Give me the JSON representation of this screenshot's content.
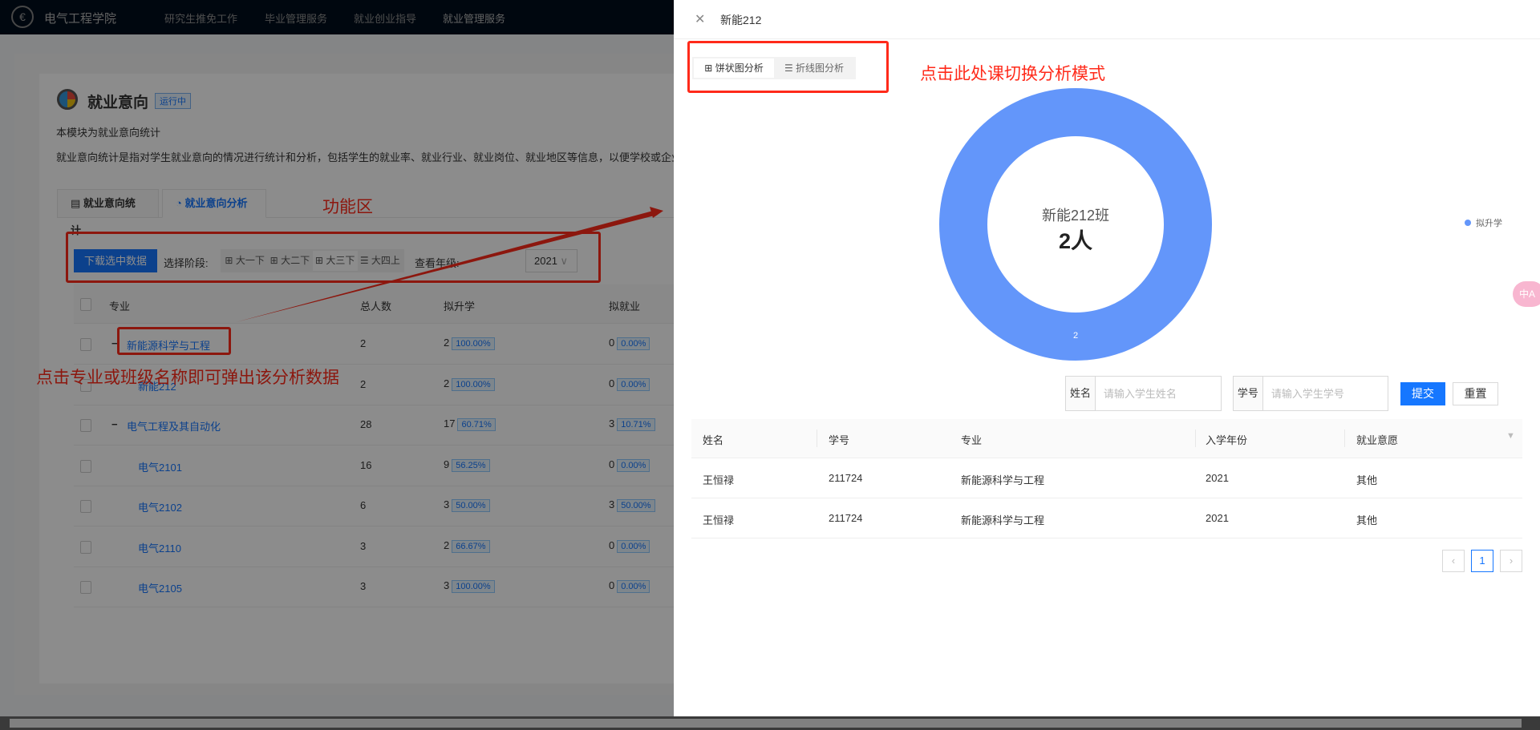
{
  "nav": {
    "title": "电气工程学院",
    "items": [
      "研究生推免工作",
      "毕业管理服务",
      "就业创业指导",
      "就业管理服务"
    ]
  },
  "page": {
    "title": "就业意向",
    "status": "运行中",
    "desc1": "本模块为就业意向统计",
    "desc2": "就业意向统计是指对学生就业意向的情况进行统计和分析，包括学生的就业率、就业行业、就业岗位、就业地区等信息，以便学校或企业更"
  },
  "tabs": [
    "就业意向统计",
    "就业意向分析"
  ],
  "toolbar": {
    "download": "下载选中数据",
    "stage_label": "选择阶段:",
    "stages": [
      "大一下",
      "大二下",
      "大三下",
      "大四上"
    ],
    "active_stage": "大三下",
    "grade_label": "查看年级:",
    "grade": "2021"
  },
  "table": {
    "headers": [
      "专业",
      "总人数",
      "拟升学",
      "拟就业"
    ],
    "rows": [
      {
        "name": "新能源科学与工程",
        "total": "2",
        "up": "2",
        "up_pct": "100.00%",
        "job": "0",
        "job_pct": "0.00%",
        "level": 0
      },
      {
        "name": "新能212",
        "total": "2",
        "up": "2",
        "up_pct": "100.00%",
        "job": "0",
        "job_pct": "0.00%",
        "level": 1
      },
      {
        "name": "电气工程及其自动化",
        "total": "28",
        "up": "17",
        "up_pct": "60.71%",
        "job": "3",
        "job_pct": "10.71%",
        "level": 0
      },
      {
        "name": "电气2101",
        "total": "16",
        "up": "9",
        "up_pct": "56.25%",
        "job": "0",
        "job_pct": "0.00%",
        "level": 1
      },
      {
        "name": "电气2102",
        "total": "6",
        "up": "3",
        "up_pct": "50.00%",
        "job": "3",
        "job_pct": "50.00%",
        "level": 1
      },
      {
        "name": "电气2110",
        "total": "3",
        "up": "2",
        "up_pct": "66.67%",
        "job": "0",
        "job_pct": "0.00%",
        "level": 1
      },
      {
        "name": "电气2105",
        "total": "3",
        "up": "3",
        "up_pct": "100.00%",
        "job": "0",
        "job_pct": "0.00%",
        "level": 1
      }
    ]
  },
  "annotations": {
    "func": "功能区",
    "click": "点击专业或班级名称即可弹出该分析数据",
    "switch": "点击此处课切换分析模式"
  },
  "drawer": {
    "title": "新能212",
    "modes": [
      "饼状图分析",
      "折线图分析"
    ],
    "active_mode": "饼状图分析",
    "form": {
      "name_label": "姓名",
      "name_placeholder": "请输入学生姓名",
      "id_label": "学号",
      "id_placeholder": "请输入学生学号",
      "submit": "提交",
      "reset": "重置"
    },
    "table": {
      "headers": [
        "姓名",
        "学号",
        "专业",
        "入学年份",
        "就业意愿"
      ],
      "rows": [
        [
          "王恒禄",
          "211724",
          "新能源科学与工程",
          "2021",
          "其他"
        ],
        [
          "王恒禄",
          "211724",
          "新能源科学与工程",
          "2021",
          "其他"
        ]
      ]
    },
    "pagination": {
      "current": "1"
    }
  },
  "chart_data": {
    "type": "pie",
    "donut": true,
    "center_title": "新能212班",
    "center_value": "2人",
    "categories": [
      "拟升学"
    ],
    "values": [
      2
    ],
    "data_labels": [
      "2"
    ],
    "legend": [
      "拟升学"
    ],
    "legend_placement": "right",
    "colors": [
      "#6396fa"
    ]
  }
}
